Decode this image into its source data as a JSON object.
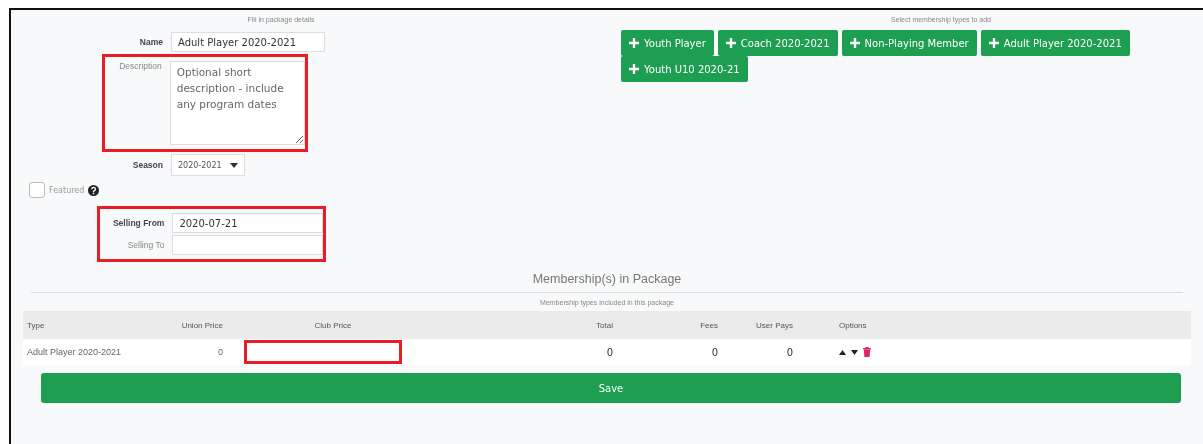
{
  "details": {
    "heading": "Fill in package details",
    "name": {
      "label": "Name",
      "value": "Adult Player 2020-2021"
    },
    "description": {
      "label": "Description",
      "placeholder": "Optional short description - include any program dates",
      "highlighted": true
    },
    "season": {
      "label": "Season",
      "value": "2020-2021"
    },
    "featured": {
      "label": "Featured",
      "checked": false
    },
    "selling": {
      "highlighted": true,
      "from": {
        "label": "Selling From",
        "value": "2020-07-21"
      },
      "to": {
        "label": "Selling To"
      }
    }
  },
  "types": {
    "heading": "Select membership types to add",
    "buttons": [
      "Youth Player",
      "Coach 2020-2021",
      "Non-Playing Member",
      "Adult Player 2020-2021",
      "Youth U10 2020-21"
    ]
  },
  "package": {
    "title": "Membership(s) in Package",
    "subtitle": "Membership types included in this package",
    "columns": [
      "Type",
      "Union Price",
      "Club Price",
      "Total",
      "Fees",
      "User Pays",
      "Options"
    ],
    "rows": [
      {
        "type": "Adult Player 2020-2021",
        "union_price": "0",
        "club_price_highlighted": true,
        "total": "0",
        "fees": "0",
        "user_pays": "0"
      }
    ]
  },
  "save": "Save"
}
